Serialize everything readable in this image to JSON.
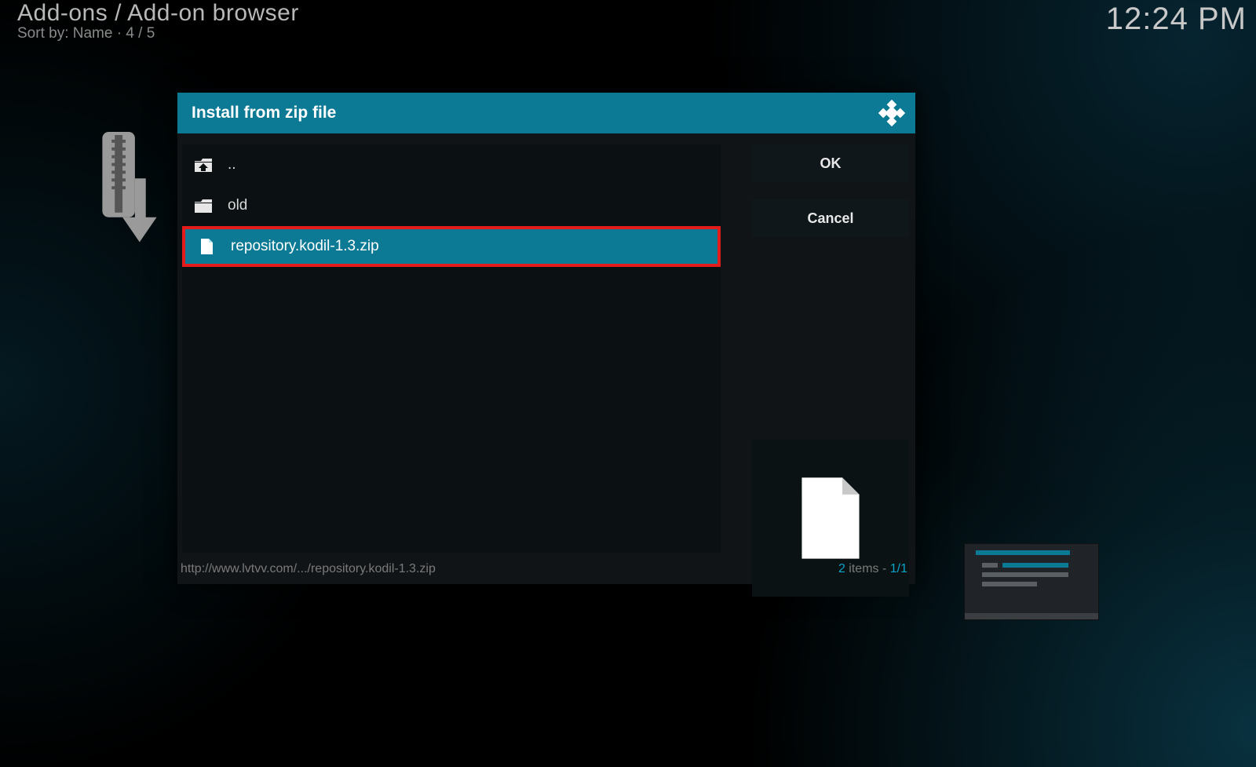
{
  "header": {
    "breadcrumb": "Add-ons / Add-on browser",
    "sort_line": "Sort by: Name  ·  4 / 5"
  },
  "clock": "12:24 PM",
  "dialog": {
    "title": "Install from zip file",
    "items": [
      {
        "kind": "up",
        "label": "..",
        "selected": false,
        "highlighted": false
      },
      {
        "kind": "folder",
        "label": "old",
        "selected": false,
        "highlighted": false
      },
      {
        "kind": "file",
        "label": "repository.kodil-1.3.zip",
        "selected": true,
        "highlighted": true
      }
    ],
    "buttons": {
      "ok": "OK",
      "cancel": "Cancel"
    },
    "footer_path": "http://www.lvtvv.com/.../repository.kodil-1.3.zip",
    "footer_items_count": "2",
    "footer_items_word": " items - ",
    "footer_page": "1/1"
  }
}
